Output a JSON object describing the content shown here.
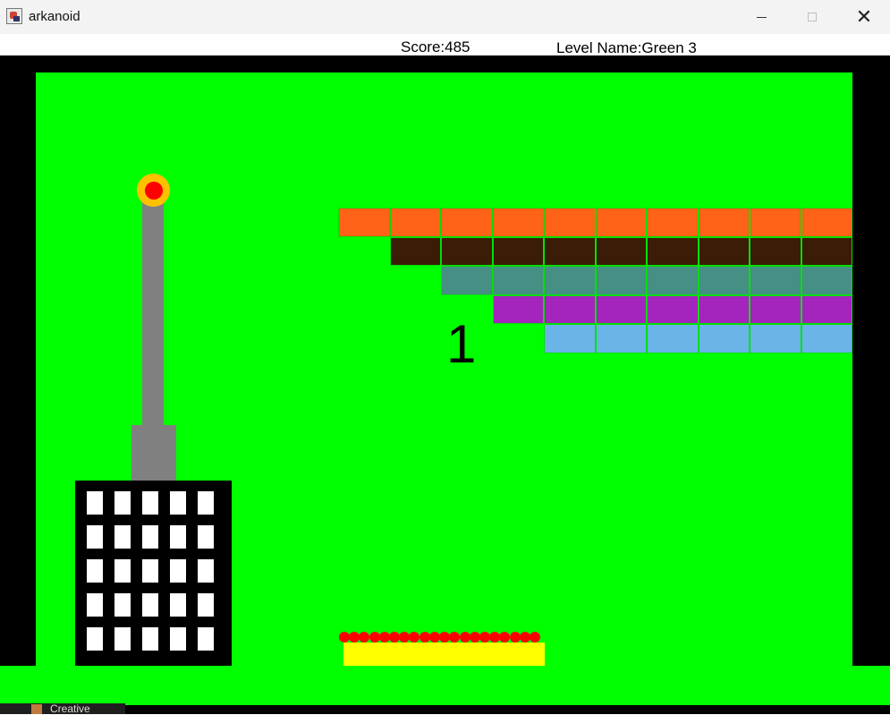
{
  "window": {
    "title": "arkanoid",
    "app_icon": "java-cup-icon",
    "controls": [
      "minimize-icon",
      "maximize-icon",
      "close-icon"
    ]
  },
  "hud": {
    "score": "Score:485",
    "level_name": "Level Name:Green 3"
  },
  "game": {
    "countdown": "1",
    "colors": {
      "field": "#00ff00",
      "border": "#000000",
      "paddle": "#ffff00",
      "ball": "#ff0000",
      "tower": "#808080",
      "building": "#000000",
      "building_window": "#ffffff",
      "beacon_outer": "#ffc000",
      "beacon_inner": "#ff0000"
    },
    "brick_rows": [
      {
        "color": "#ff6317",
        "count": 10
      },
      {
        "color": "#3b1c06",
        "count": 9
      },
      {
        "color": "#458f85",
        "count": 8
      },
      {
        "color": "#a325be",
        "count": 7
      },
      {
        "color": "#6ab4e8",
        "count": 6
      }
    ],
    "balls_count": 20,
    "building_window_grid": {
      "rows": 5,
      "cols": 5
    }
  },
  "taskbar": {
    "label": "Creative"
  }
}
